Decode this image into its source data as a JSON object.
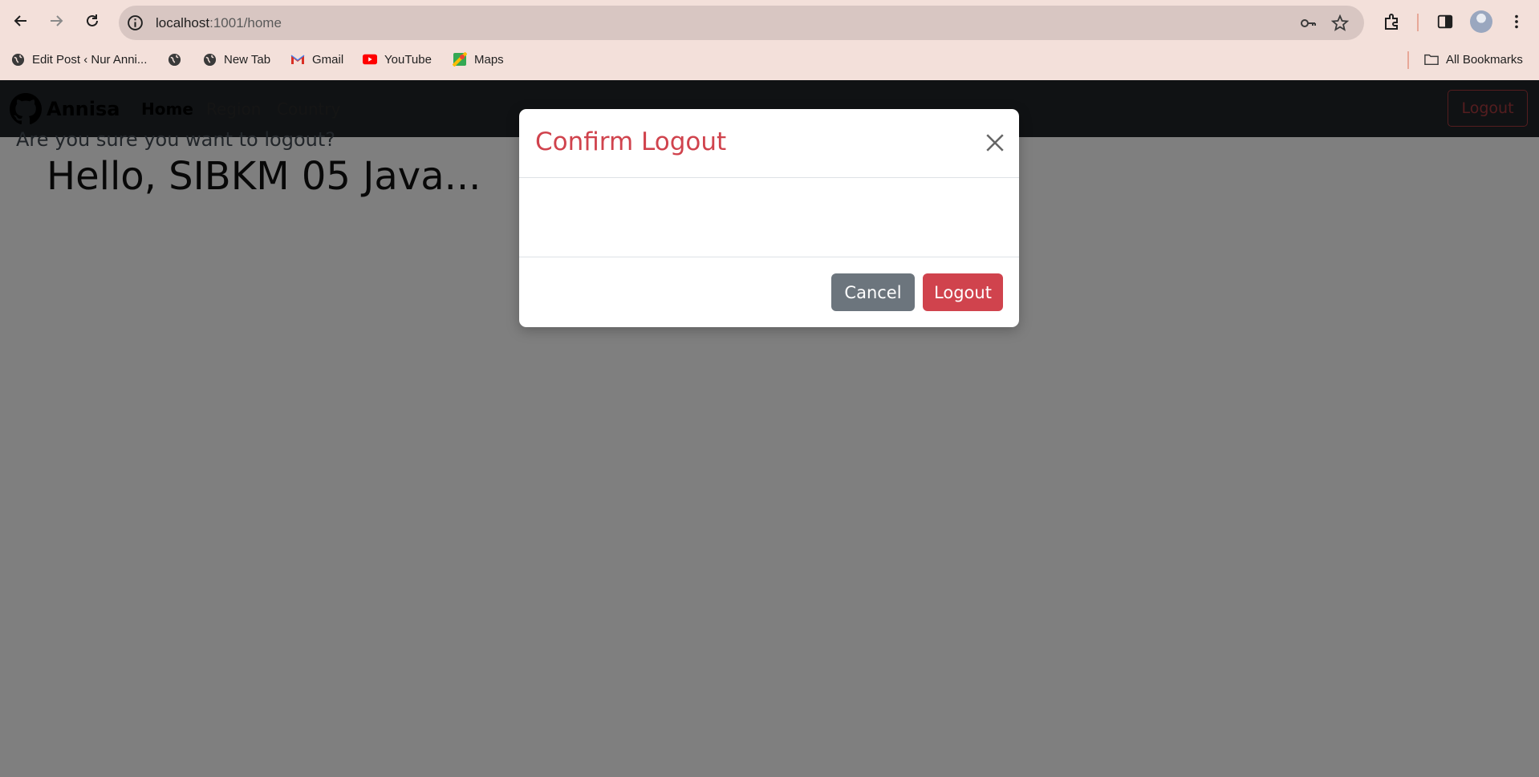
{
  "browser": {
    "url_host": "localhost",
    "url_path": ":1001/home",
    "bookmarks": [
      {
        "label": "Edit Post ‹ Nur Anni...",
        "icon": "globe-icon"
      },
      {
        "label": "",
        "icon": "globe-icon"
      },
      {
        "label": "New Tab",
        "icon": "globe-icon"
      },
      {
        "label": "Gmail",
        "icon": "gmail-icon"
      },
      {
        "label": "YouTube",
        "icon": "youtube-icon"
      },
      {
        "label": "Maps",
        "icon": "maps-icon"
      }
    ],
    "all_bookmarks_label": "All Bookmarks"
  },
  "navbar": {
    "brand": "Annisa",
    "links": [
      "Home",
      "Region",
      "Country"
    ],
    "active_link": "Home",
    "logout_label": "Logout"
  },
  "main": {
    "greeting": "Hello, SIBKM 05 Java..."
  },
  "modal": {
    "title": "Confirm Logout",
    "message": "Are you sure you want to logout?",
    "cancel_label": "Cancel",
    "confirm_label": "Logout"
  },
  "colors": {
    "danger": "#d0434d",
    "secondary": "#6c757d",
    "navbar": "#212529",
    "chrome": "#f3e0da"
  }
}
